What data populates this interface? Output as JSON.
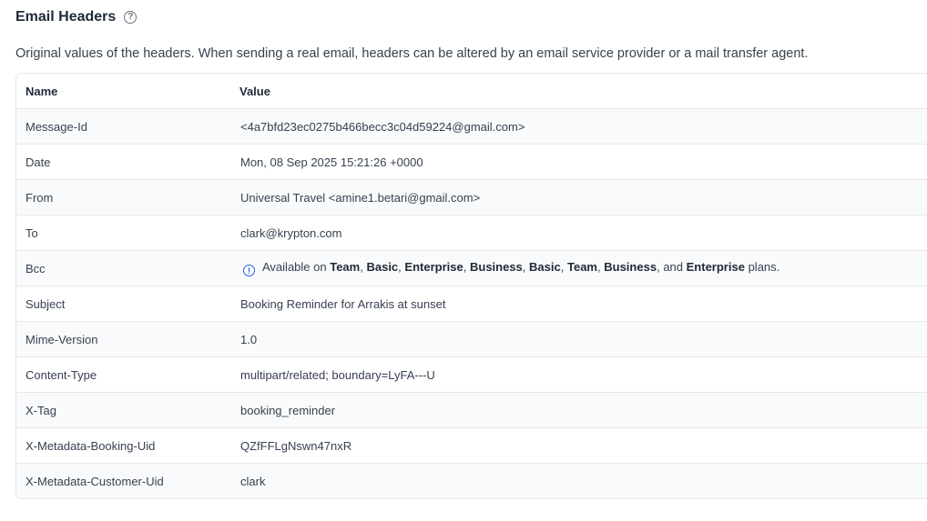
{
  "header": {
    "title": "Email Headers",
    "help_icon": "question-circle-icon"
  },
  "description": "Original values of the headers. When sending a real email, headers can be altered by an email service provider or a mail transfer agent.",
  "table": {
    "columns": [
      "Name",
      "Value"
    ],
    "rows": [
      {
        "name": "Message-Id",
        "value": "<4a7bfd23ec0275b466becc3c04d59224@gmail.com>"
      },
      {
        "name": "Date",
        "value": "Mon, 08 Sep 2025 15:21:26 +0000"
      },
      {
        "name": "From",
        "value": "Universal Travel <amine1.betari@gmail.com>"
      },
      {
        "name": "To",
        "value": "clark@krypton.com"
      },
      {
        "name": "Bcc",
        "value": ""
      },
      {
        "name": "Subject",
        "value": "Booking Reminder for Arrakis at sunset"
      },
      {
        "name": "Mime-Version",
        "value": "1.0"
      },
      {
        "name": "Content-Type",
        "value": "multipart/related; boundary=LyFA---U"
      },
      {
        "name": "X-Tag",
        "value": "booking_reminder"
      },
      {
        "name": "X-Metadata-Booking-Uid",
        "value": "QZfFFLgNswn47nxR"
      },
      {
        "name": "X-Metadata-Customer-Uid",
        "value": "clark"
      }
    ]
  },
  "bcc_notice": {
    "icon": "info-circle-icon",
    "prefix": "Available on",
    "plans": [
      "Team",
      "Basic",
      "Enterprise",
      "Business",
      "Basic",
      "Team",
      "Business"
    ],
    "conjunction": "and",
    "last_plan": "Enterprise",
    "suffix": "plans.",
    "accent_color": "#2563eb"
  }
}
